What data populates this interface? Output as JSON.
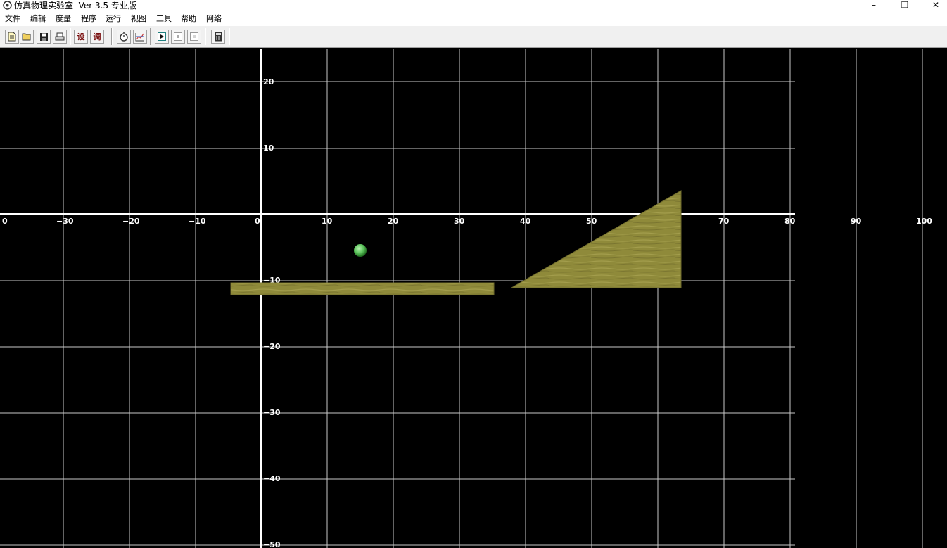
{
  "window": {
    "title": "仿真物理实验室  Ver 3.5 专业版",
    "minimize_glyph": "–",
    "restore_glyph": "❐",
    "close_glyph": "✕"
  },
  "menu": {
    "items": [
      "文件",
      "编辑",
      "度量",
      "程序",
      "运行",
      "视图",
      "工具",
      "帮助",
      "网络"
    ]
  },
  "toolbar": {
    "buttons": [
      {
        "icon": "new-file-icon"
      },
      {
        "icon": "open-folder-icon"
      },
      {
        "icon": "save-icon"
      },
      {
        "icon": "print-icon"
      },
      {
        "label": "设"
      },
      {
        "label": "调"
      },
      {
        "icon": "stopwatch-icon"
      },
      {
        "icon": "graph-icon"
      },
      {
        "icon": "play-icon"
      },
      {
        "icon": "stop-icon"
      },
      {
        "icon": "pause-icon"
      },
      {
        "icon": "calculator-icon"
      }
    ]
  },
  "canvas": {
    "background": "#000000",
    "grid_color": "#c8c8c8",
    "axis_color": "#ffffff",
    "x_tick_labels": [
      "0",
      "−30",
      "−20",
      "−10",
      "0",
      "10",
      "20",
      "30",
      "40",
      "50",
      "70",
      "80",
      "90",
      "100"
    ],
    "y_tick_labels": [
      "20",
      "10",
      "−10",
      "−20",
      "−30",
      "−40",
      "−50"
    ],
    "objects": [
      {
        "type": "ball",
        "name": "green-ball",
        "color": "#5cc45c"
      },
      {
        "type": "plank",
        "name": "wooden-plank",
        "color": "#8f8a3a"
      },
      {
        "type": "wedge",
        "name": "wooden-wedge",
        "color": "#8f8a3a"
      }
    ]
  }
}
